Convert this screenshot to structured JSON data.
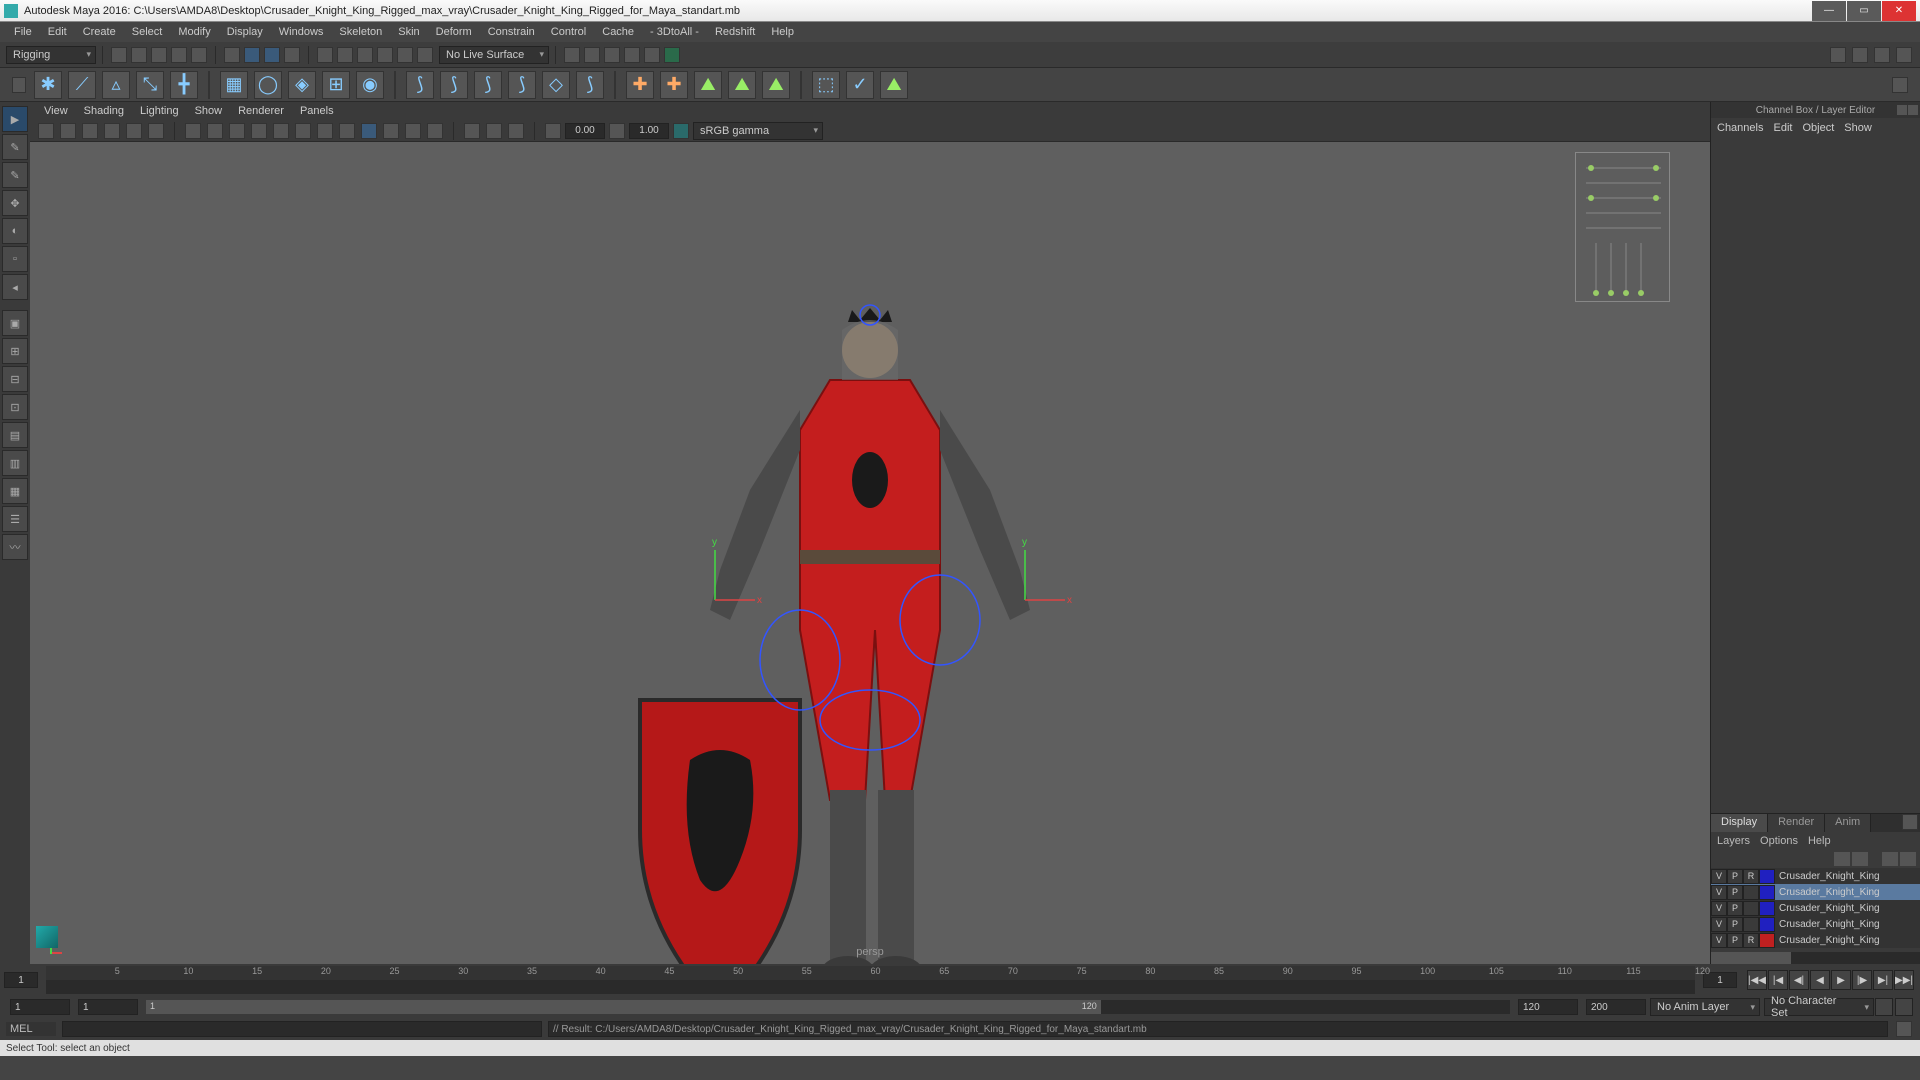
{
  "title": "Autodesk Maya 2016: C:\\Users\\AMDA8\\Desktop\\Crusader_Knight_King_Rigged_max_vray\\Crusader_Knight_King_Rigged_for_Maya_standart.mb",
  "menu": [
    "File",
    "Edit",
    "Create",
    "Select",
    "Modify",
    "Display",
    "Windows",
    "Skeleton",
    "Skin",
    "Deform",
    "Constrain",
    "Control",
    "Cache",
    "- 3DtoAll -",
    "Redshift",
    "Help"
  ],
  "workspace": "Rigging",
  "liveSurface": "No Live Surface",
  "vpMenu": [
    "View",
    "Shading",
    "Lighting",
    "Show",
    "Renderer",
    "Panels"
  ],
  "vpNum1": "0.00",
  "vpNum2": "1.00",
  "colorMgmt": "sRGB gamma",
  "cameraLabel": "persp",
  "channelBox": {
    "header": "Channel Box / Layer Editor",
    "tabs": [
      "Channels",
      "Edit",
      "Object",
      "Show"
    ]
  },
  "layerEditor": {
    "tabs": [
      "Display",
      "Render",
      "Anim"
    ],
    "opts": [
      "Layers",
      "Options",
      "Help"
    ],
    "rows": [
      {
        "v": "V",
        "p": "P",
        "r": "R",
        "color": "#2020c0",
        "name": "Crusader_Knight_King",
        "sel": false
      },
      {
        "v": "V",
        "p": "P",
        "r": "",
        "color": "#2020c0",
        "name": "Crusader_Knight_King",
        "sel": true
      },
      {
        "v": "V",
        "p": "P",
        "r": "",
        "color": "#2020c0",
        "name": "Crusader_Knight_King",
        "sel": false
      },
      {
        "v": "V",
        "p": "P",
        "r": "",
        "color": "#2020c0",
        "name": "Crusader_Knight_King",
        "sel": false
      },
      {
        "v": "V",
        "p": "P",
        "r": "R",
        "color": "#c02020",
        "name": "Crusader_Knight_King",
        "sel": false
      }
    ]
  },
  "timeline": {
    "start": "1",
    "current": "1",
    "ticks": [
      5,
      10,
      15,
      20,
      25,
      30,
      35,
      40,
      45,
      50,
      55,
      60,
      65,
      70,
      75,
      80,
      85,
      90,
      95,
      100,
      105,
      110,
      115,
      120
    ]
  },
  "range": {
    "in": "1",
    "inner": "1",
    "sliderLabel": "120",
    "out": "120",
    "end": "200"
  },
  "animLayer": "No Anim Layer",
  "charSet": "No Character Set",
  "cmd": {
    "lang": "MEL",
    "result": "// Result: C:/Users/AMDA8/Desktop/Crusader_Knight_King_Rigged_max_vray/Crusader_Knight_King_Rigged_for_Maya_standart.mb"
  },
  "status": "Select Tool: select an object"
}
